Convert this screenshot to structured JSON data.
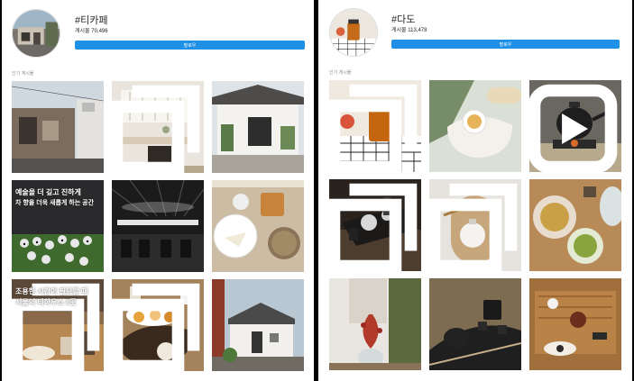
{
  "left": {
    "hashtag": "#티카페",
    "post_count": "게시물 70,496",
    "follow_label": "팔로우",
    "section_label": "인기 게시물",
    "overlay_texts": {
      "tile4": [
        "예술을 더 깊고 진하게",
        "차 향을 더욱 새롭게 하는 공간"
      ],
      "tile7": [
        "조용한 시간이 필요할 때",
        "서울의 티하우스 8곳"
      ]
    }
  },
  "right": {
    "hashtag": "#다도",
    "post_count": "게시물 113,478",
    "follow_label": "팔로우",
    "section_label": "인기 게시물"
  },
  "colors": {
    "accent": "#1e90e6"
  },
  "icons": {
    "multi_post": "multi-post-icon",
    "reel": "reel-icon"
  }
}
